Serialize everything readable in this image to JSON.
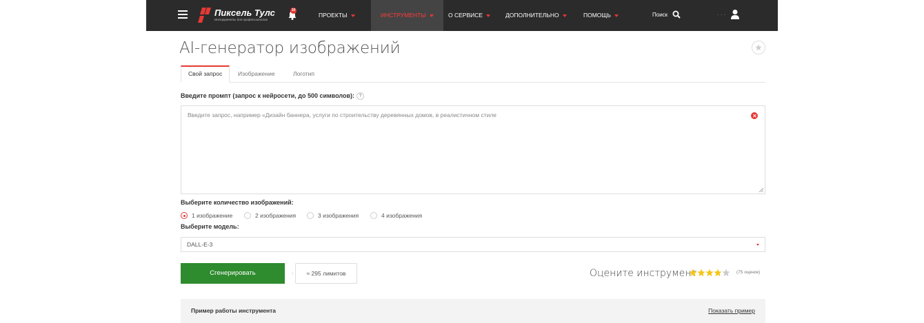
{
  "header": {
    "logo_title": "Пиксель Тулс",
    "logo_subtitle": "Инструменты для профессионалов",
    "notification_count": "10",
    "nav": [
      {
        "label": "ПРОЕКТЫ",
        "active": false
      },
      {
        "label": "ИНСТРУМЕНТЫ",
        "active": true
      },
      {
        "label": "О СЕРВИСЕ",
        "active": false
      },
      {
        "label": "ДОПОЛНИТЕЛЬНО",
        "active": false
      },
      {
        "label": "ПОМОЩЬ",
        "active": false
      }
    ],
    "search_label": "Поиск",
    "user_dots": "· · ·"
  },
  "page": {
    "title": "AI-генератор изображений"
  },
  "tabs": [
    {
      "label": "Свой запрос",
      "active": true
    },
    {
      "label": "Изображение",
      "active": false
    },
    {
      "label": "Логотип",
      "active": false
    }
  ],
  "prompt": {
    "label": "Введите промпт (запрос к нейросети, до 500 символов):",
    "help": "?",
    "placeholder": "Введите запрос, например «Дизайн баннера, услуги по строительству деревянных домов, в реалистичном стиле"
  },
  "count": {
    "label": "Выберите количество изображений:",
    "options": [
      {
        "label": "1 изображение",
        "checked": true
      },
      {
        "label": "2 изображения",
        "checked": false
      },
      {
        "label": "3 изображения",
        "checked": false
      },
      {
        "label": "4 изображения",
        "checked": false
      }
    ]
  },
  "model": {
    "label": "Выберите модель:",
    "selected": "DALL-E-3"
  },
  "actions": {
    "generate_label": "Сгенерировать",
    "limits_label": "≈ 295 лимитов"
  },
  "rating": {
    "label": "Оцените инструмент",
    "stars_filled": 4,
    "stars_total": 5,
    "count_label": "(75 оценок)",
    "star_color": "#f5c518"
  },
  "example": {
    "title": "Пример работы инструмента",
    "link": "Показать пример"
  },
  "colors": {
    "accent": "#e53935",
    "header_bg": "#2b2b2b",
    "button_green": "#2e8b2e"
  }
}
